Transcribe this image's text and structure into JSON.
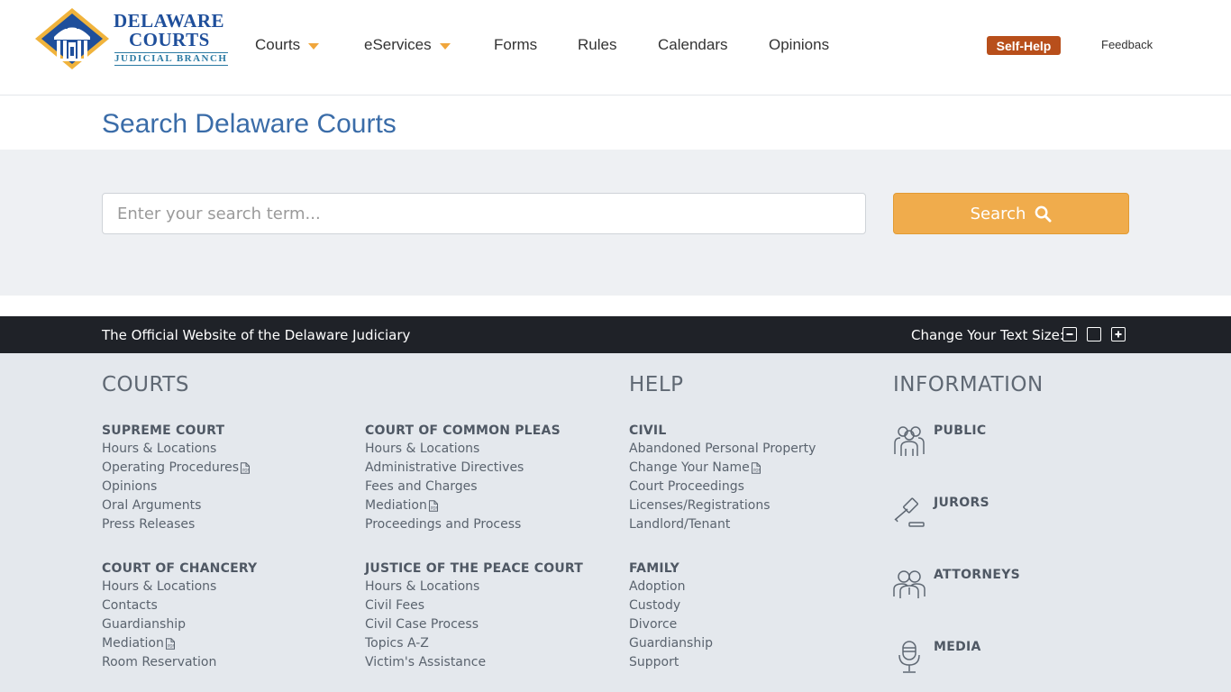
{
  "header": {
    "logo": {
      "line1": "DELAWARE",
      "line2": "COURTS",
      "line3": "JUDICIAL BRANCH"
    },
    "nav": [
      {
        "label": "Courts",
        "has_dropdown": true
      },
      {
        "label": "eServices",
        "has_dropdown": true
      },
      {
        "label": "Forms",
        "has_dropdown": false
      },
      {
        "label": "Rules",
        "has_dropdown": false
      },
      {
        "label": "Calendars",
        "has_dropdown": false
      },
      {
        "label": "Opinions",
        "has_dropdown": false
      }
    ],
    "self_help_label": "Self-Help",
    "feedback_label": "Feedback"
  },
  "page": {
    "title": "Search Delaware Courts"
  },
  "search": {
    "placeholder": "Enter your search term...",
    "value": "",
    "button_label": "Search"
  },
  "footer_bar": {
    "official_text": "The Official Website of the Delaware Judiciary",
    "text_size_label": "Change Your Text Size:",
    "text_size_buttons": [
      "decrease",
      "reset",
      "increase"
    ]
  },
  "footer": {
    "courts_heading": "COURTS",
    "help_heading": "HELP",
    "information_heading": "INFORMATION",
    "courts_groups": [
      {
        "title": "SUPREME COURT",
        "links": [
          {
            "label": "Hours & Locations",
            "pdf": false
          },
          {
            "label": "Operating Procedures",
            "pdf": true
          },
          {
            "label": "Opinions",
            "pdf": false
          },
          {
            "label": "Oral Arguments",
            "pdf": false
          },
          {
            "label": "Press Releases",
            "pdf": false
          }
        ]
      },
      {
        "title": "COURT OF COMMON PLEAS",
        "links": [
          {
            "label": "Hours & Locations",
            "pdf": false
          },
          {
            "label": "Administrative Directives",
            "pdf": false
          },
          {
            "label": "Fees and Charges",
            "pdf": false
          },
          {
            "label": "Mediation",
            "pdf": true
          },
          {
            "label": "Proceedings and Process",
            "pdf": false
          }
        ]
      },
      {
        "title": "COURT OF CHANCERY",
        "links": [
          {
            "label": "Hours & Locations",
            "pdf": false
          },
          {
            "label": "Contacts",
            "pdf": false
          },
          {
            "label": "Guardianship",
            "pdf": false
          },
          {
            "label": "Mediation",
            "pdf": true
          },
          {
            "label": "Room Reservation",
            "pdf": false
          }
        ]
      },
      {
        "title": "JUSTICE OF THE PEACE COURT",
        "links": [
          {
            "label": "Hours & Locations",
            "pdf": false
          },
          {
            "label": "Civil Fees",
            "pdf": false
          },
          {
            "label": "Civil Case Process",
            "pdf": false
          },
          {
            "label": "Topics A-Z",
            "pdf": false
          },
          {
            "label": "Victim's Assistance",
            "pdf": false
          }
        ]
      }
    ],
    "help_groups": [
      {
        "title": "CIVIL",
        "links": [
          {
            "label": "Abandoned Personal Property",
            "pdf": false
          },
          {
            "label": "Change Your Name",
            "pdf": true
          },
          {
            "label": "Court Proceedings",
            "pdf": false
          },
          {
            "label": "Licenses/Registrations",
            "pdf": false
          },
          {
            "label": "Landlord/Tenant",
            "pdf": false
          }
        ]
      },
      {
        "title": "FAMILY",
        "links": [
          {
            "label": "Adoption",
            "pdf": false
          },
          {
            "label": "Custody",
            "pdf": false
          },
          {
            "label": "Divorce",
            "pdf": false
          },
          {
            "label": "Guardianship",
            "pdf": false
          },
          {
            "label": "Support",
            "pdf": false
          }
        ]
      }
    ],
    "information_items": [
      {
        "label": "PUBLIC",
        "icon": "public-group-icon"
      },
      {
        "label": "JURORS",
        "icon": "gavel-icon"
      },
      {
        "label": "ATTORNEYS",
        "icon": "attorneys-icon"
      },
      {
        "label": "MEDIA",
        "icon": "microphone-icon"
      }
    ]
  },
  "colors": {
    "brand_blue": "#1f4f9b",
    "title_blue": "#3a6ca8",
    "accent_orange": "#f0ac4c",
    "self_help_bg": "#b84f1b",
    "footer_bar_bg": "#1f2228",
    "footer_bg": "#e4e8ed",
    "search_band_bg": "#eef0f3"
  }
}
